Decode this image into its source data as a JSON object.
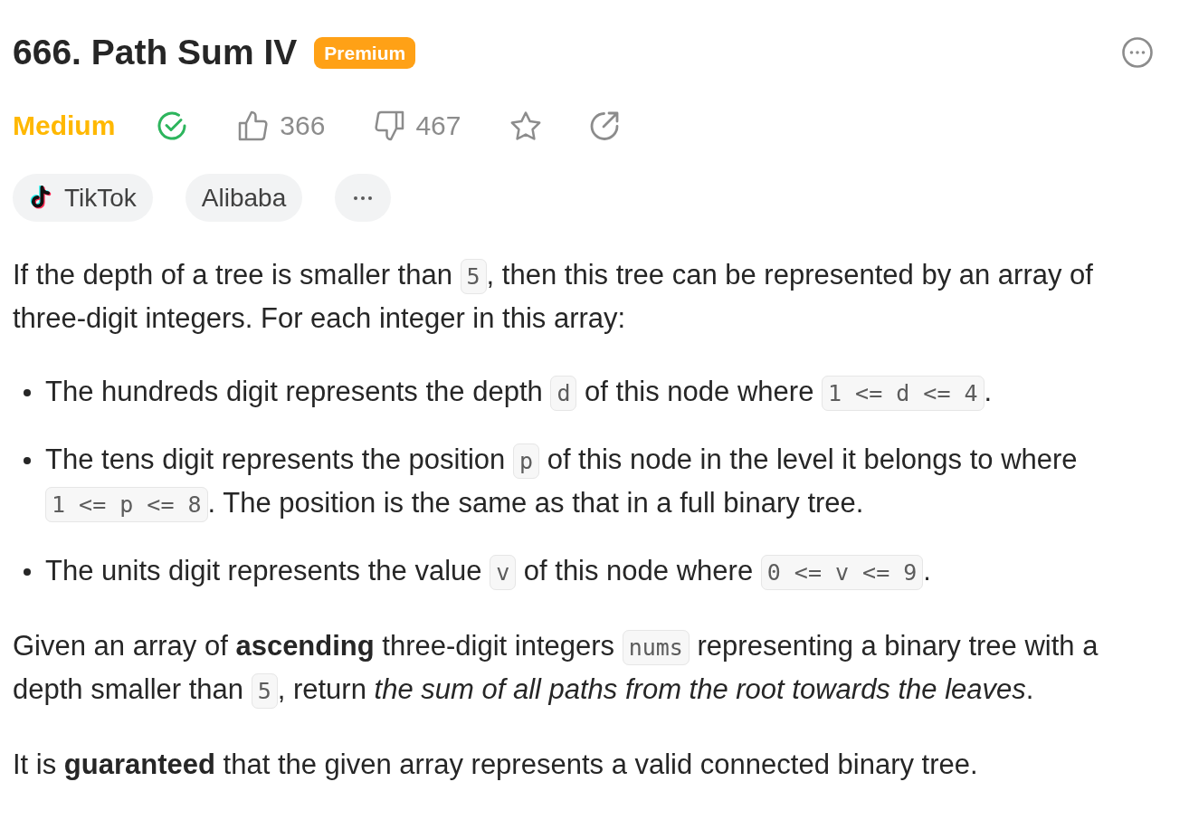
{
  "header": {
    "title": "666. Path Sum IV",
    "badge": "Premium"
  },
  "stats": {
    "difficulty": {
      "label": "Medium",
      "kind": "medium"
    },
    "solved": true,
    "likes": "366",
    "dislikes": "467"
  },
  "tags": [
    {
      "label": "TikTok",
      "kind": "logo"
    },
    {
      "label": "Alibaba",
      "kind": "plain"
    }
  ],
  "description": [
    {
      "kind": "paragraph",
      "parts": [
        {
          "kind": "text",
          "text": "If the depth of a tree is smaller than "
        },
        {
          "kind": "code",
          "text": "5"
        },
        {
          "kind": "text",
          "text": ", then this tree can be represented by an array of three-digit integers. For each integer in this array:"
        }
      ]
    },
    {
      "kind": "list",
      "items": [
        {
          "parts": [
            {
              "kind": "text",
              "text": "The hundreds digit represents the depth "
            },
            {
              "kind": "code",
              "text": "d"
            },
            {
              "kind": "text",
              "text": " of this node where "
            },
            {
              "kind": "code",
              "text": "1 <= d <= 4"
            },
            {
              "kind": "text",
              "text": "."
            }
          ]
        },
        {
          "parts": [
            {
              "kind": "text",
              "text": "The tens digit represents the position "
            },
            {
              "kind": "code",
              "text": "p"
            },
            {
              "kind": "text",
              "text": " of this node in the level it belongs to where "
            },
            {
              "kind": "code",
              "text": "1 <= p <= 8"
            },
            {
              "kind": "text",
              "text": ". The position is the same as that in a full binary tree."
            }
          ]
        },
        {
          "parts": [
            {
              "kind": "text",
              "text": "The units digit represents the value "
            },
            {
              "kind": "code",
              "text": "v"
            },
            {
              "kind": "text",
              "text": " of this node where "
            },
            {
              "kind": "code",
              "text": "0 <= v <= 9"
            },
            {
              "kind": "text",
              "text": "."
            }
          ]
        }
      ]
    },
    {
      "kind": "paragraph",
      "parts": [
        {
          "kind": "text",
          "text": "Given an array of **ascending** three-digit integers "
        },
        {
          "kind": "code",
          "text": "nums"
        },
        {
          "kind": "text",
          "text": " representing a binary tree with a depth smaller than "
        },
        {
          "kind": "code",
          "text": "5"
        },
        {
          "kind": "text",
          "text": ", return *the sum of all paths from the root towards the leaves*."
        }
      ]
    },
    {
      "kind": "paragraph",
      "parts": [
        {
          "kind": "text",
          "text": "It is **guaranteed** that the given array represents a valid connected binary tree."
        }
      ]
    }
  ]
}
